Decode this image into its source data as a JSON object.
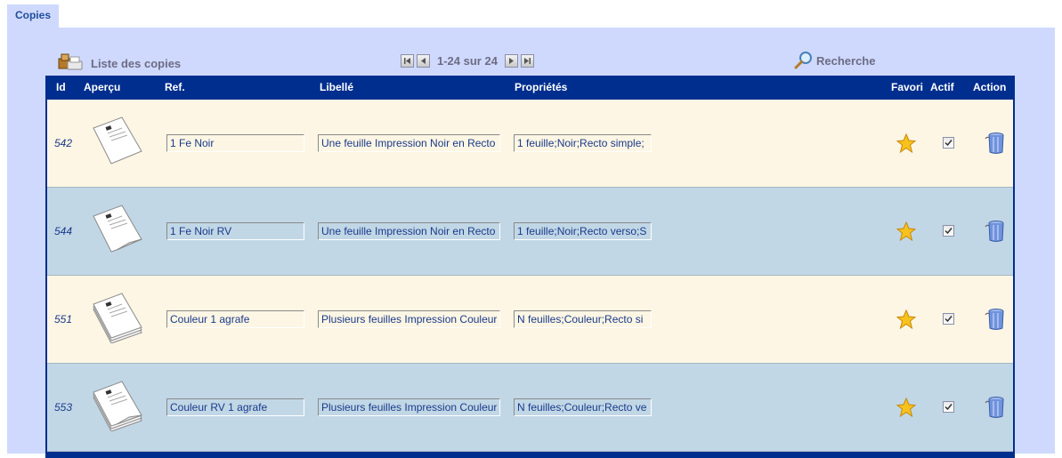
{
  "tab": {
    "label": "Copies"
  },
  "toolbar": {
    "list_title": "Liste des copies",
    "pager_text": "1-24 sur 24",
    "search_label": "Recherche"
  },
  "table": {
    "headers": {
      "id": "Id",
      "apercu": "Aperçu",
      "ref": "Ref.",
      "libelle": "Libellé",
      "proprietes": "Propriétés",
      "favori": "Favori",
      "actif": "Actif",
      "action": "Action"
    },
    "rows": [
      {
        "id": "542",
        "ref": "1 Fe Noir",
        "libelle": "Une feuille Impression Noir en Recto",
        "proprietes": "1 feuille;Noir;Recto simple;",
        "thumb": "single-sheet-icon",
        "favori": true,
        "actif": true
      },
      {
        "id": "544",
        "ref": "1 Fe Noir RV",
        "libelle": "Une feuille Impression Noir en Recto",
        "proprietes": "1 feuille;Noir;Recto verso;S",
        "thumb": "single-sheet-curled-icon",
        "favori": true,
        "actif": true
      },
      {
        "id": "551",
        "ref": "Couleur 1 agrafe",
        "libelle": "Plusieurs feuilles Impression Couleur",
        "proprietes": "N feuilles;Couleur;Recto si",
        "thumb": "stacked-sheets-icon",
        "favori": true,
        "actif": true
      },
      {
        "id": "553",
        "ref": "Couleur RV 1 agrafe",
        "libelle": "Plusieurs feuilles Impression Couleur",
        "proprietes": "N feuilles;Couleur;Recto ve",
        "thumb": "stacked-sheets-curled-icon",
        "favori": true,
        "actif": true
      }
    ]
  },
  "colors": {
    "panel": "#cfd9fd",
    "header": "#002e8e",
    "row_odd": "#fdf6e4",
    "row_even": "#c1d7e6",
    "link_text": "#1a3a8a"
  }
}
